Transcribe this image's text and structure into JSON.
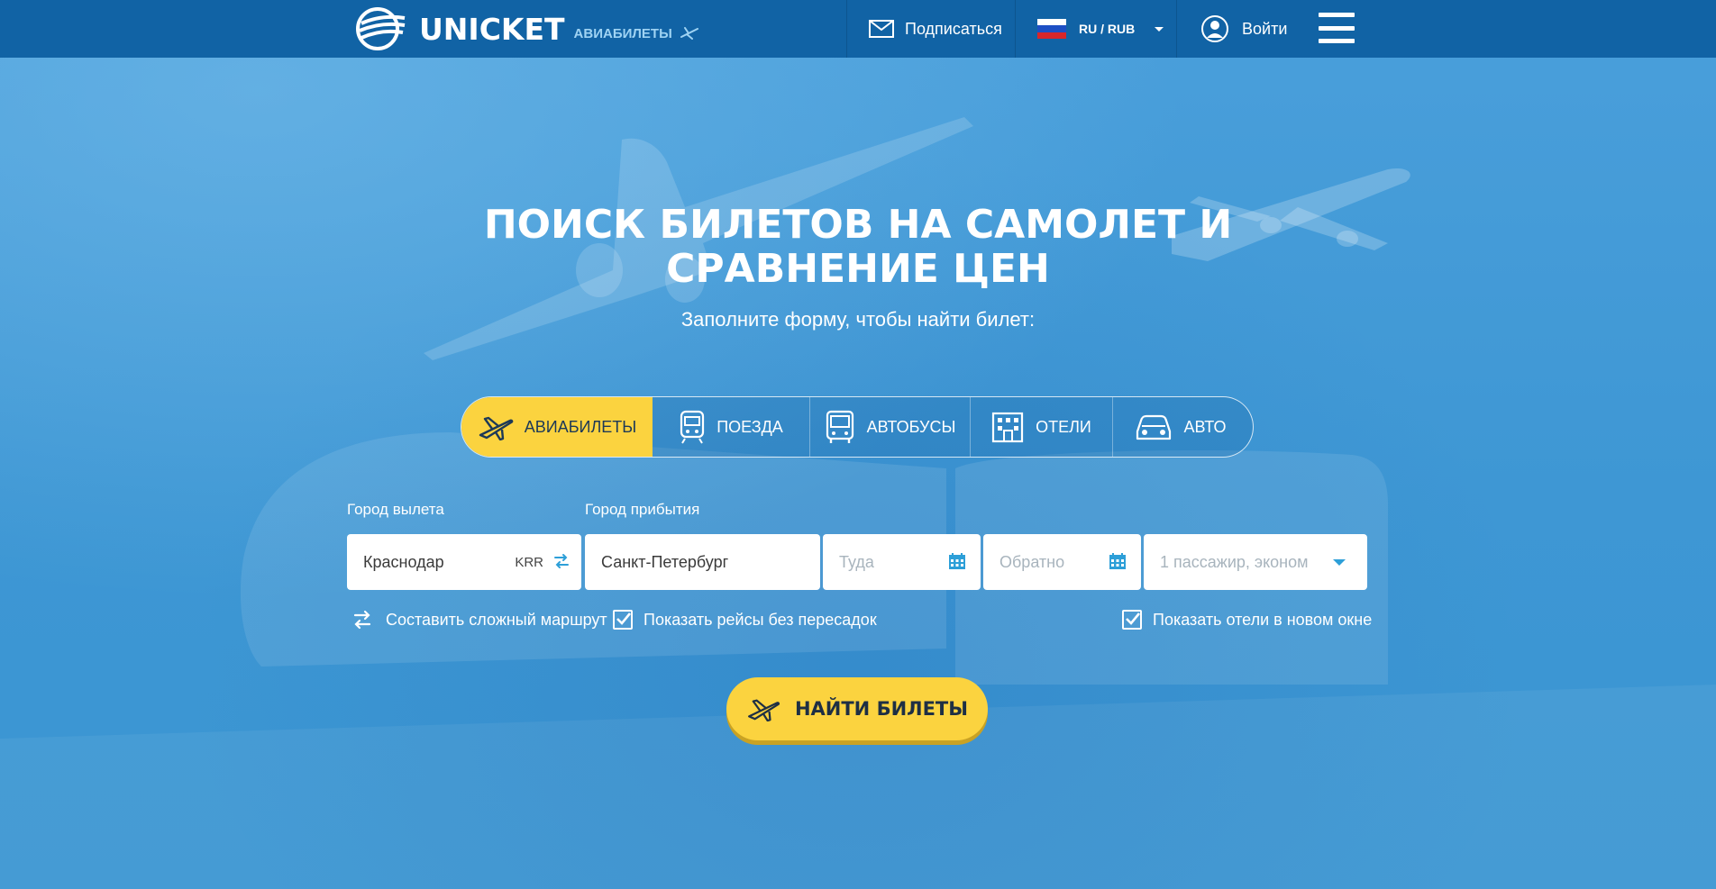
{
  "header": {
    "logo_text": "UNICKET",
    "logo_subtitle": "АВИАБИЛЕТЫ",
    "subscribe_label": "Подписаться",
    "lang_label": "RU / RUB",
    "login_label": "Войти"
  },
  "hero": {
    "title_line1": "ПОИСК БИЛЕТОВ НА САМОЛЕТ И",
    "title_line2": "СРАВНЕНИЕ ЦЕН",
    "subtitle": "Заполните форму, чтобы найти билет:"
  },
  "tabs": [
    {
      "label": "АВИАБИЛЕТЫ",
      "icon": "plane-icon",
      "active": true
    },
    {
      "label": "ПОЕЗДА",
      "icon": "train-icon",
      "active": false
    },
    {
      "label": "АВТОБУСЫ",
      "icon": "bus-icon",
      "active": false
    },
    {
      "label": "ОТЕЛИ",
      "icon": "hotel-icon",
      "active": false
    },
    {
      "label": "АВТО",
      "icon": "car-icon",
      "active": false
    }
  ],
  "form": {
    "from_label": "Город вылета",
    "to_label": "Город прибытия",
    "from_value": "Краснодар",
    "from_iata": "KRR",
    "to_value": "Санкт-Петербург",
    "depart_placeholder": "Туда",
    "return_placeholder": "Обратно",
    "passengers_placeholder": "1 пассажир, эконом",
    "complex_route_label": "Составить сложный маршрут",
    "direct_only_label": "Показать рейсы без пересадок",
    "hotels_new_window_label": "Показать отели в новом окне",
    "direct_only_checked": true,
    "hotels_new_window_checked": true
  },
  "search_button_label": "НАЙТИ БИЛЕТЫ",
  "colors": {
    "topbar": "#1163a5",
    "hero_bg": "#3d9ad6",
    "accent_yellow": "#fbd33f",
    "icon_blue": "#2d9fd8"
  }
}
